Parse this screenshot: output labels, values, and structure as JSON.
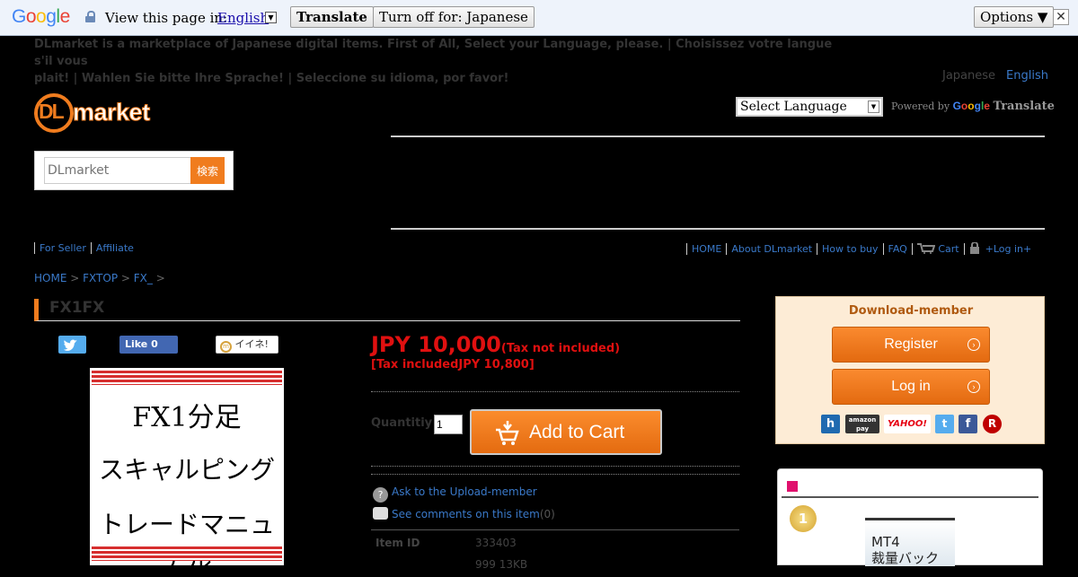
{
  "gtranslate": {
    "logo": "Google",
    "view_text": "View this page in:",
    "language": "English",
    "translate_label": "Translate",
    "turn_off_label": "Turn off for: Japanese",
    "options_label": "Options ▼",
    "close": "✕"
  },
  "notice": {
    "line1": "DLmarket is a marketplace of Japanese digital items. First of All, Select your Language, please. | Choisissez votre langue s'il vous",
    "line2": "plait! | Wahlen Sie bitte Ihre Sprache! | Seleccione su idioma, por favor!"
  },
  "lang_switch": {
    "japanese": "Japanese",
    "english": "English"
  },
  "logo": {
    "dl": "DL",
    "market": "market"
  },
  "search": {
    "placeholder": "DLmarket",
    "button": "検索"
  },
  "google_select": {
    "label": "Select Language",
    "powered": "Powered by",
    "google": "Google",
    "translate": "Translate"
  },
  "nav_left": [
    "For Seller",
    "Affiliate"
  ],
  "nav_right": {
    "home": "HOME",
    "about": "About DLmarket",
    "how": "How to buy",
    "faq": "FAQ",
    "cart": "Cart",
    "login": "+Log in+"
  },
  "breadcrumb": {
    "home": "HOME",
    "sep": ">",
    "fxtop": "FXTOP",
    "fx": "FX_"
  },
  "product": {
    "title": "FX1FX",
    "like_label": "Like 0",
    "iine_label": "イイネ!",
    "image_lines": [
      "FX1分足",
      "スキャルピング",
      "トレードマニュアル"
    ],
    "price": "JPY 10,000",
    "tax_note": "(Tax not included)",
    "tax_included": "[Tax includedJPY 10,800]",
    "quantity_label": "Quantitiy",
    "quantity_value": "1",
    "add_to_cart": "Add to Cart",
    "ask": "Ask to the Upload-member",
    "comments": "See comments on this item",
    "comments_count": "(0)",
    "item_id_label": "Item ID",
    "item_id": "333403",
    "item_extra": "999 13KB"
  },
  "member": {
    "title": "Download-member",
    "register": "Register",
    "login": "Log in",
    "social": {
      "h": "h",
      "amazon": "amazon pay",
      "yahoo": "YAHOO!",
      "twitter": "t",
      "facebook": "f",
      "rakuten": "R"
    }
  },
  "ranking": {
    "medal": "1",
    "thumb_line1": "MT4",
    "thumb_line2": "裁量バック"
  },
  "colors": {
    "accent": "#f07c1e",
    "price": "#e01010",
    "link": "#3a79c9"
  }
}
